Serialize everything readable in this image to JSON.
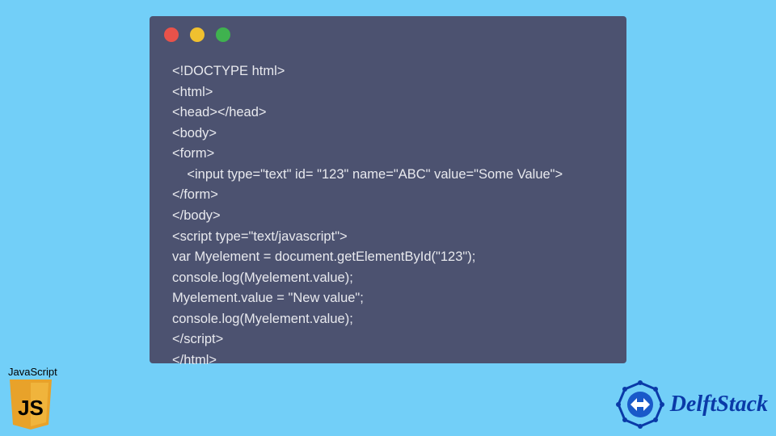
{
  "code": {
    "lines": [
      "<!DOCTYPE html>",
      "<html>",
      "<head></head>",
      "<body>",
      "<form>",
      "    <input type=\"text\" id= \"123\" name=\"ABC\" value=\"Some Value\">",
      "</form>",
      "</body>",
      "<script type=\"text/javascript\">",
      "var Myelement = document.getElementById(\"123\");",
      "console.log(Myelement.value);",
      "Myelement.value = \"New value\";",
      "console.log(Myelement.value);",
      "</script>",
      "</html>"
    ]
  },
  "badges": {
    "js_label": "JavaScript",
    "js_text": "JS",
    "brand_name": "DelftStack"
  },
  "colors": {
    "background": "#72cff8",
    "window": "#4c5270",
    "code_text": "#e8e9ee",
    "dot_red": "#e9524a",
    "dot_yellow": "#f0c02f",
    "dot_green": "#3fb24f",
    "js_shield": "#e8a22a",
    "js_text": "#000000",
    "brand_text": "#0a3aa8"
  }
}
